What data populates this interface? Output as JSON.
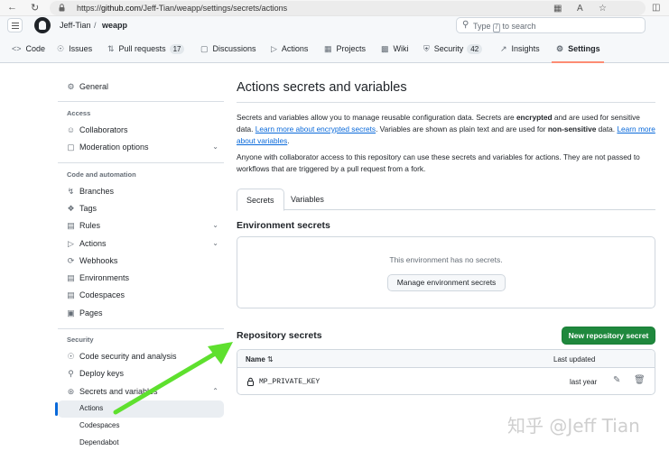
{
  "browser": {
    "url_prefix": "https://",
    "url_host": "github.com",
    "url_path": "/Jeff-Tian/weapp/settings/secrets/actions"
  },
  "header": {
    "owner": "Jeff-Tian",
    "separator": "/",
    "repo": "weapp",
    "search_before": "Type",
    "search_key": "/",
    "search_after": "to search"
  },
  "repo_tabs": [
    {
      "label": "Code",
      "icon": "code-icon"
    },
    {
      "label": "Issues",
      "icon": "issue-icon"
    },
    {
      "label": "Pull requests",
      "icon": "pull-request-icon",
      "count": "17"
    },
    {
      "label": "Discussions",
      "icon": "discussion-icon"
    },
    {
      "label": "Actions",
      "icon": "play-icon"
    },
    {
      "label": "Projects",
      "icon": "table-icon"
    },
    {
      "label": "Wiki",
      "icon": "book-icon"
    },
    {
      "label": "Security",
      "icon": "shield-icon",
      "count": "42"
    },
    {
      "label": "Insights",
      "icon": "graph-icon"
    },
    {
      "label": "Settings",
      "icon": "gear-icon",
      "selected": true
    }
  ],
  "sidebar": {
    "general": "General",
    "access_heading": "Access",
    "collaborators": "Collaborators",
    "moderation": "Moderation options",
    "code_heading": "Code and automation",
    "branches": "Branches",
    "tags": "Tags",
    "rules": "Rules",
    "actions": "Actions",
    "webhooks": "Webhooks",
    "environments": "Environments",
    "codespaces": "Codespaces",
    "pages": "Pages",
    "security_heading": "Security",
    "code_security": "Code security and analysis",
    "deploy_keys": "Deploy keys",
    "secrets_vars": "Secrets and variables",
    "sub_actions": "Actions",
    "sub_codespaces": "Codespaces",
    "sub_dependabot": "Dependabot"
  },
  "main": {
    "title": "Actions secrets and variables",
    "p1_a": "Secrets and variables allow you to manage reusable configuration data. Secrets are ",
    "p1_b": "encrypted",
    "p1_c": " and are used for sensitive data. ",
    "p1_link1": "Learn more about encrypted secrets",
    "p1_d": ". Variables are shown as plain text and are used for ",
    "p1_e": "non-sensitive",
    "p1_f": " data. ",
    "p1_link2": "Learn more about variables",
    "p1_g": ".",
    "p2": "Anyone with collaborator access to this repository can use these secrets and variables for actions. They are not passed to workflows that are triggered by a pull request from a fork.",
    "tab_secrets": "Secrets",
    "tab_variables": "Variables",
    "env_heading": "Environment secrets",
    "env_empty": "This environment has no secrets.",
    "env_button": "Manage environment secrets",
    "repo_heading": "Repository secrets",
    "new_secret_button": "New repository secret",
    "col_name": "Name",
    "col_updated": "Last updated",
    "secrets": [
      {
        "name": "MP_PRIVATE_KEY",
        "updated": "last year"
      }
    ]
  },
  "overlay": {
    "arrow_color": "#5ee02e",
    "watermark": "知乎 @Jeff Tian"
  }
}
